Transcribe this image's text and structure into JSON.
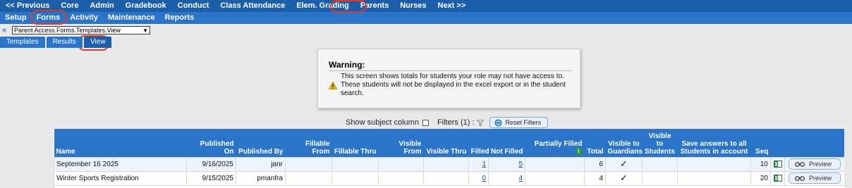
{
  "top_nav": [
    "<< Previous",
    "Core",
    "Admin",
    "Gradebook",
    "Conduct",
    "Class Attendance",
    "Elem. Grading",
    "Parents",
    "Nurses",
    "Next >>"
  ],
  "sub_nav": [
    "Setup",
    "Forms",
    "Activity",
    "Maintenance",
    "Reports"
  ],
  "path_selector": {
    "value": "Parent Access.Forms.Templates.View"
  },
  "tabs": [
    "Templates",
    "Results",
    "View"
  ],
  "warning": {
    "title": "Warning:",
    "message": "This screen shows totals for students your role may not have access to. These students will not be displayed in the excel export or in the student search."
  },
  "filters": {
    "show_subject_label": "Show subject column",
    "filters_label": "Filters (1) :",
    "reset_label": "Reset Filters"
  },
  "table": {
    "columns": [
      "Name",
      "Published On",
      "Published By",
      "Fillable From",
      "Fillable Thru",
      "Visible From",
      "Visible Thru",
      "Filled",
      "Not Filled",
      "Partially Filled",
      "Total",
      "Visible to Guardians",
      "Visible to Students",
      "Save answers to all Students in account",
      "Seq",
      "",
      ""
    ],
    "rows": [
      {
        "name": "September 16 2025",
        "published_on": "9/16/2025",
        "published_by": "janr",
        "filled": "1",
        "not_filled": "5",
        "total": "6",
        "guardians": "✓",
        "seq": "10",
        "preview": "Preview"
      },
      {
        "name": "Winter Sports Registration",
        "published_on": "9/15/2025",
        "published_by": "pmanfra",
        "filled": "0",
        "not_filled": "4",
        "total": "4",
        "guardians": "✓",
        "seq": "20",
        "preview": "Preview"
      }
    ]
  },
  "colors": {
    "nav_dark": "#1b5faa",
    "nav_light": "#2a75c9",
    "highlight": "#e0392b"
  }
}
